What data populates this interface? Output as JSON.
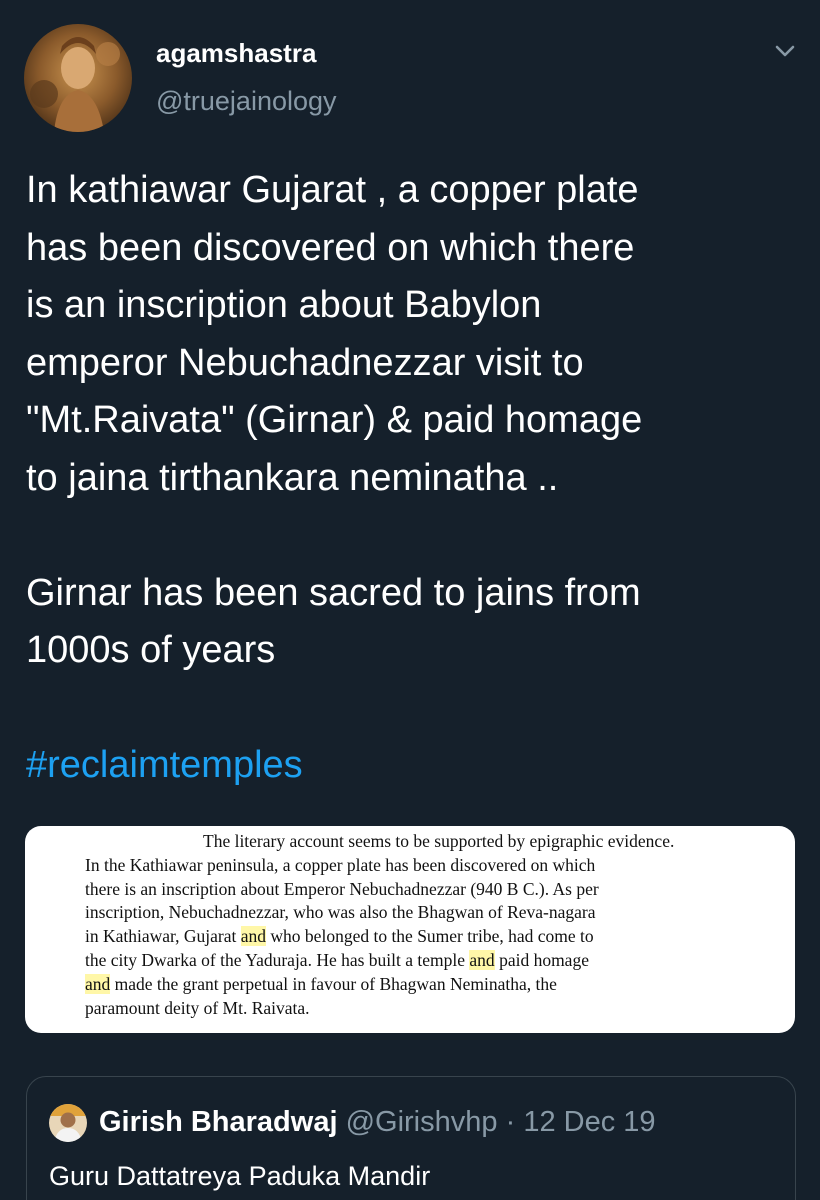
{
  "tweet": {
    "author": {
      "display_name": "agamshastra",
      "handle": "@truejainology",
      "avatar_icon": "avatar-painting-icon"
    },
    "menu_icon": "chevron-down-icon",
    "text_lines": [
      "In kathiawar Gujarat , a copper plate",
      "has been discovered on which there",
      "is an inscription about Babylon",
      "emperor Nebuchadnezzar visit to",
      "\"Mt.Raivata\" (Girnar) & paid homage",
      "to jaina tirthankara neminatha .."
    ],
    "text_lines_2": [
      "Girnar has been sacred to jains from",
      "1000s of years"
    ],
    "hashtag": "#reclaimtemples"
  },
  "media": {
    "lines": [
      "The literary account seems to be supported by epigraphic evidence.",
      "In the Kathiawar peninsula, a copper plate has been discovered on which",
      "there is an inscription about Emperor Nebuchadnezzar (940 B C.). As per",
      "inscription, Nebuchadnezzar, who was also the Bhagwan of Reva-nagara"
    ],
    "line5_pre": "in Kathiawar, Gujarat ",
    "line5_hl": "and",
    "line5_post": " who belonged to the Sumer tribe, had come to",
    "line6_pre": "the city Dwarka of the Yaduraja. He has built a temple ",
    "line6_hl": "and",
    "line6_post": " paid homage",
    "line7_hl": "and",
    "line7_post": " made the grant perpetual in favour of Bhagwan Neminatha, the",
    "line8": "paramount deity of Mt. Raivata.",
    "highlight_color": "#fff7a8"
  },
  "quoted_tweet": {
    "avatar_icon": "avatar-photo-icon",
    "display_name": "Girish Bharadwaj",
    "handle": "@Girishvhp",
    "separator": "·",
    "date": "12 Dec 19",
    "text": "Guru Dattatreya Paduka Mandir"
  },
  "colors": {
    "background": "#15202b",
    "text": "#ffffff",
    "muted": "#8899a6",
    "link": "#1da1f2",
    "border": "#38444d"
  }
}
